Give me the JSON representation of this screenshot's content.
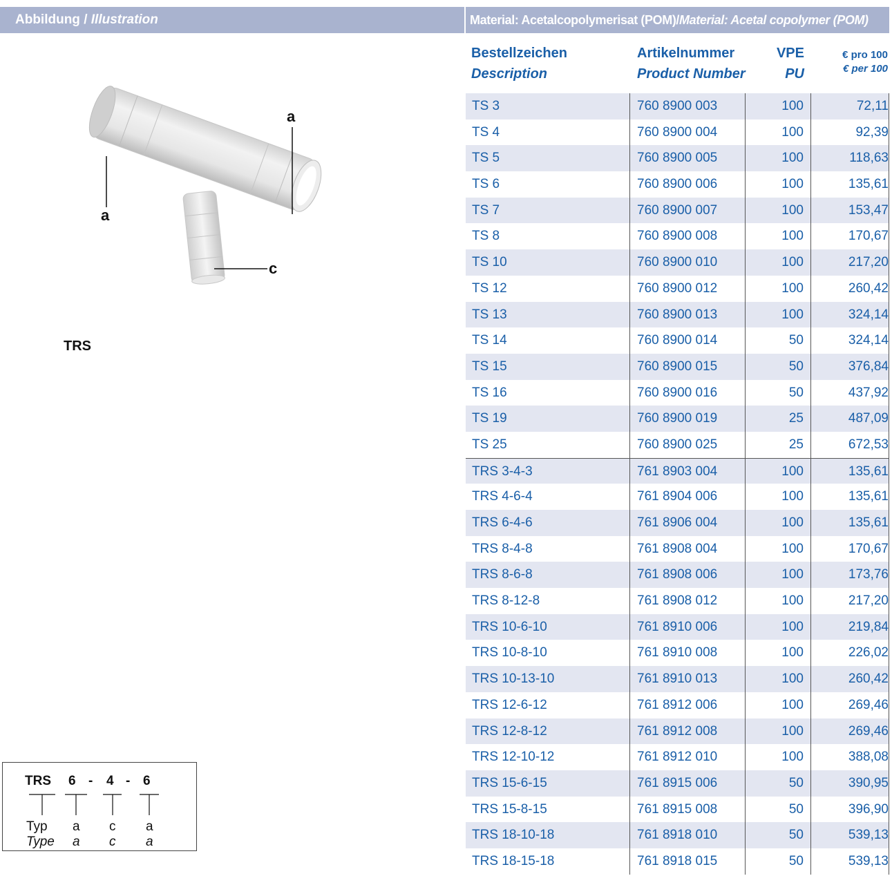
{
  "header": {
    "left_label": "Abbildung / ",
    "left_label_italic": "Illustration",
    "right_label": "Material: Acetalcopolymerisat (POM)/",
    "right_label_italic": "Material: Acetal copolymer (POM)"
  },
  "illustration": {
    "label_a_top": "a",
    "label_a_left": "a",
    "label_c": "c",
    "product_name": "TRS"
  },
  "type_box": {
    "top": [
      "TRS",
      "6",
      "-",
      "4",
      "-",
      "6"
    ],
    "row_de": [
      "Typ",
      "a",
      "c",
      "a"
    ],
    "row_en": [
      "Type",
      "a",
      "c",
      "a"
    ]
  },
  "table": {
    "headers": {
      "desc_de": "Bestellzeichen",
      "desc_en": "Description",
      "num_de": "Artikelnummer",
      "num_en": "Product Number",
      "pu_de": "VPE",
      "pu_en": "PU",
      "price_de": "€ pro 100",
      "price_en": "€ per 100"
    },
    "rows": [
      [
        "TS 3",
        "760 8900 003",
        "100",
        "72,11"
      ],
      [
        "TS 4",
        "760 8900 004",
        "100",
        "92,39"
      ],
      [
        "TS 5",
        "760 8900 005",
        "100",
        "118,63"
      ],
      [
        "TS 6",
        "760 8900 006",
        "100",
        "135,61"
      ],
      [
        "TS 7",
        "760 8900 007",
        "100",
        "153,47"
      ],
      [
        "TS 8",
        "760 8900 008",
        "100",
        "170,67"
      ],
      [
        "TS 10",
        "760 8900 010",
        "100",
        "217,20"
      ],
      [
        "TS 12",
        "760 8900 012",
        "100",
        "260,42"
      ],
      [
        "TS 13",
        "760 8900 013",
        "100",
        "324,14"
      ],
      [
        "TS 14",
        "760 8900 014",
        "50",
        "324,14"
      ],
      [
        "TS 15",
        "760 8900 015",
        "50",
        "376,84"
      ],
      [
        "TS 16",
        "760 8900 016",
        "50",
        "437,92"
      ],
      [
        "TS 19",
        "760 8900 019",
        "25",
        "487,09"
      ],
      [
        "TS 25",
        "760 8900 025",
        "25",
        "672,53"
      ],
      [
        "TRS 3-4-3",
        "761 8903 004",
        "100",
        "135,61"
      ],
      [
        "TRS 4-6-4",
        "761 8904 006",
        "100",
        "135,61"
      ],
      [
        "TRS 6-4-6",
        "761 8906 004",
        "100",
        "135,61"
      ],
      [
        "TRS 8-4-8",
        "761 8908 004",
        "100",
        "170,67"
      ],
      [
        "TRS 8-6-8",
        "761 8908 006",
        "100",
        "173,76"
      ],
      [
        "TRS 8-12-8",
        "761 8908 012",
        "100",
        "217,20"
      ],
      [
        "TRS 10-6-10",
        "761 8910 006",
        "100",
        "219,84"
      ],
      [
        "TRS 10-8-10",
        "761 8910 008",
        "100",
        "226,02"
      ],
      [
        "TRS 10-13-10",
        "761 8910 013",
        "100",
        "260,42"
      ],
      [
        "TRS 12-6-12",
        "761 8912 006",
        "100",
        "269,46"
      ],
      [
        "TRS 12-8-12",
        "761 8912 008",
        "100",
        "269,46"
      ],
      [
        "TRS 12-10-12",
        "761 8912 010",
        "100",
        "388,08"
      ],
      [
        "TRS 15-6-15",
        "761 8915 006",
        "50",
        "390,95"
      ],
      [
        "TRS 15-8-15",
        "761 8915 008",
        "50",
        "396,90"
      ],
      [
        "TRS 18-10-18",
        "761 8918 010",
        "50",
        "539,13"
      ],
      [
        "TRS 18-15-18",
        "761 8918 015",
        "50",
        "539,13"
      ]
    ]
  },
  "colors": {
    "header_bg": "#a9b3cf",
    "text_blue": "#1a5fa8",
    "row_shade": "#e3e6f1"
  }
}
